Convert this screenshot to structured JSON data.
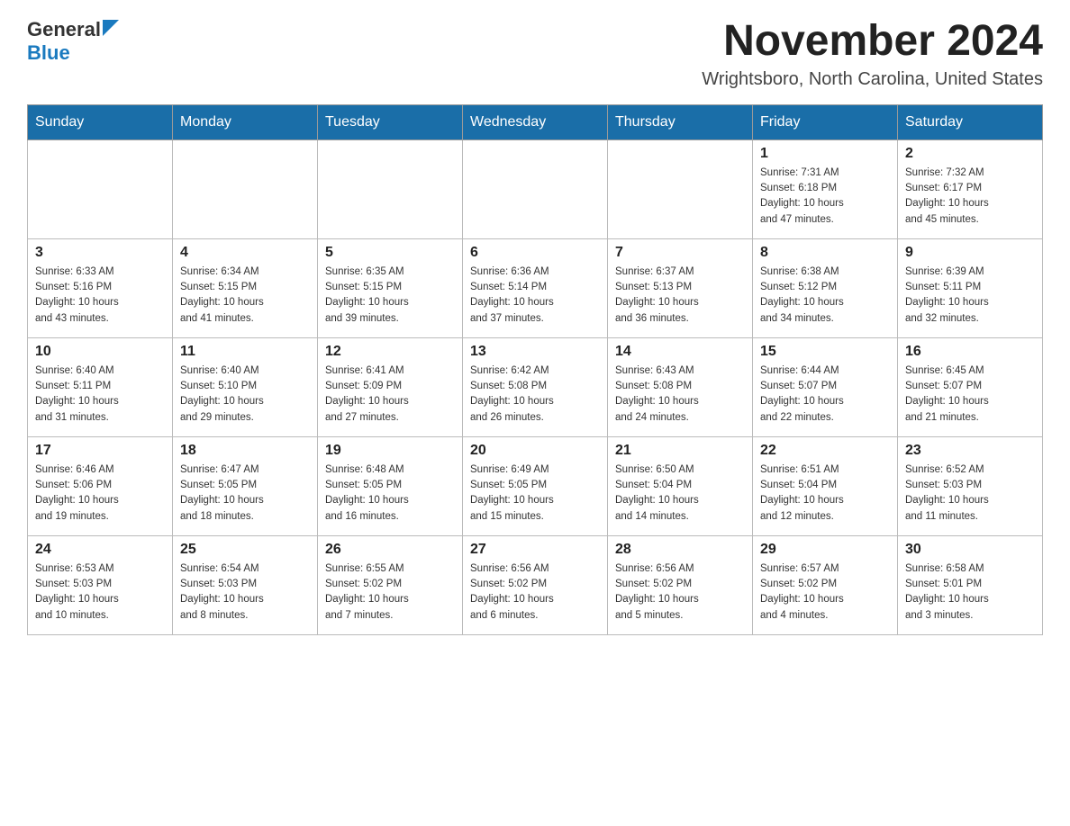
{
  "logo": {
    "general": "General",
    "blue": "Blue",
    "triangle": "▶"
  },
  "title": "November 2024",
  "location": "Wrightsboro, North Carolina, United States",
  "header_days": [
    "Sunday",
    "Monday",
    "Tuesday",
    "Wednesday",
    "Thursday",
    "Friday",
    "Saturday"
  ],
  "weeks": [
    [
      {
        "day": "",
        "info": ""
      },
      {
        "day": "",
        "info": ""
      },
      {
        "day": "",
        "info": ""
      },
      {
        "day": "",
        "info": ""
      },
      {
        "day": "",
        "info": ""
      },
      {
        "day": "1",
        "info": "Sunrise: 7:31 AM\nSunset: 6:18 PM\nDaylight: 10 hours\nand 47 minutes."
      },
      {
        "day": "2",
        "info": "Sunrise: 7:32 AM\nSunset: 6:17 PM\nDaylight: 10 hours\nand 45 minutes."
      }
    ],
    [
      {
        "day": "3",
        "info": "Sunrise: 6:33 AM\nSunset: 5:16 PM\nDaylight: 10 hours\nand 43 minutes."
      },
      {
        "day": "4",
        "info": "Sunrise: 6:34 AM\nSunset: 5:15 PM\nDaylight: 10 hours\nand 41 minutes."
      },
      {
        "day": "5",
        "info": "Sunrise: 6:35 AM\nSunset: 5:15 PM\nDaylight: 10 hours\nand 39 minutes."
      },
      {
        "day": "6",
        "info": "Sunrise: 6:36 AM\nSunset: 5:14 PM\nDaylight: 10 hours\nand 37 minutes."
      },
      {
        "day": "7",
        "info": "Sunrise: 6:37 AM\nSunset: 5:13 PM\nDaylight: 10 hours\nand 36 minutes."
      },
      {
        "day": "8",
        "info": "Sunrise: 6:38 AM\nSunset: 5:12 PM\nDaylight: 10 hours\nand 34 minutes."
      },
      {
        "day": "9",
        "info": "Sunrise: 6:39 AM\nSunset: 5:11 PM\nDaylight: 10 hours\nand 32 minutes."
      }
    ],
    [
      {
        "day": "10",
        "info": "Sunrise: 6:40 AM\nSunset: 5:11 PM\nDaylight: 10 hours\nand 31 minutes."
      },
      {
        "day": "11",
        "info": "Sunrise: 6:40 AM\nSunset: 5:10 PM\nDaylight: 10 hours\nand 29 minutes."
      },
      {
        "day": "12",
        "info": "Sunrise: 6:41 AM\nSunset: 5:09 PM\nDaylight: 10 hours\nand 27 minutes."
      },
      {
        "day": "13",
        "info": "Sunrise: 6:42 AM\nSunset: 5:08 PM\nDaylight: 10 hours\nand 26 minutes."
      },
      {
        "day": "14",
        "info": "Sunrise: 6:43 AM\nSunset: 5:08 PM\nDaylight: 10 hours\nand 24 minutes."
      },
      {
        "day": "15",
        "info": "Sunrise: 6:44 AM\nSunset: 5:07 PM\nDaylight: 10 hours\nand 22 minutes."
      },
      {
        "day": "16",
        "info": "Sunrise: 6:45 AM\nSunset: 5:07 PM\nDaylight: 10 hours\nand 21 minutes."
      }
    ],
    [
      {
        "day": "17",
        "info": "Sunrise: 6:46 AM\nSunset: 5:06 PM\nDaylight: 10 hours\nand 19 minutes."
      },
      {
        "day": "18",
        "info": "Sunrise: 6:47 AM\nSunset: 5:05 PM\nDaylight: 10 hours\nand 18 minutes."
      },
      {
        "day": "19",
        "info": "Sunrise: 6:48 AM\nSunset: 5:05 PM\nDaylight: 10 hours\nand 16 minutes."
      },
      {
        "day": "20",
        "info": "Sunrise: 6:49 AM\nSunset: 5:05 PM\nDaylight: 10 hours\nand 15 minutes."
      },
      {
        "day": "21",
        "info": "Sunrise: 6:50 AM\nSunset: 5:04 PM\nDaylight: 10 hours\nand 14 minutes."
      },
      {
        "day": "22",
        "info": "Sunrise: 6:51 AM\nSunset: 5:04 PM\nDaylight: 10 hours\nand 12 minutes."
      },
      {
        "day": "23",
        "info": "Sunrise: 6:52 AM\nSunset: 5:03 PM\nDaylight: 10 hours\nand 11 minutes."
      }
    ],
    [
      {
        "day": "24",
        "info": "Sunrise: 6:53 AM\nSunset: 5:03 PM\nDaylight: 10 hours\nand 10 minutes."
      },
      {
        "day": "25",
        "info": "Sunrise: 6:54 AM\nSunset: 5:03 PM\nDaylight: 10 hours\nand 8 minutes."
      },
      {
        "day": "26",
        "info": "Sunrise: 6:55 AM\nSunset: 5:02 PM\nDaylight: 10 hours\nand 7 minutes."
      },
      {
        "day": "27",
        "info": "Sunrise: 6:56 AM\nSunset: 5:02 PM\nDaylight: 10 hours\nand 6 minutes."
      },
      {
        "day": "28",
        "info": "Sunrise: 6:56 AM\nSunset: 5:02 PM\nDaylight: 10 hours\nand 5 minutes."
      },
      {
        "day": "29",
        "info": "Sunrise: 6:57 AM\nSunset: 5:02 PM\nDaylight: 10 hours\nand 4 minutes."
      },
      {
        "day": "30",
        "info": "Sunrise: 6:58 AM\nSunset: 5:01 PM\nDaylight: 10 hours\nand 3 minutes."
      }
    ]
  ]
}
